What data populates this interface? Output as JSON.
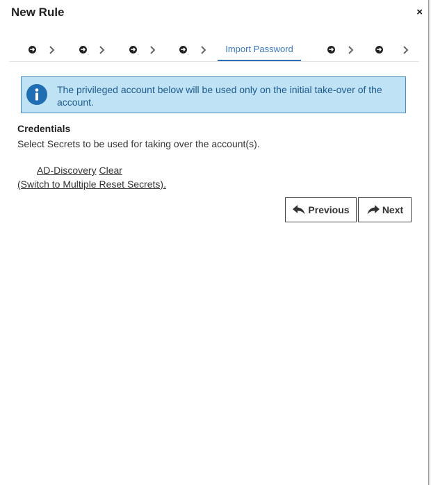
{
  "dialog": {
    "title": "New Rule",
    "close_icon": "×"
  },
  "wizard": {
    "steps": [
      {
        "icon": "arrow-circle-right-icon",
        "state": "pending"
      },
      {
        "icon": "arrow-circle-right-icon",
        "state": "pending"
      },
      {
        "icon": "arrow-circle-right-icon",
        "state": "pending"
      },
      {
        "icon": "arrow-circle-right-icon",
        "state": "pending"
      },
      {
        "label": "Import Password",
        "state": "active"
      },
      {
        "icon": "arrow-circle-right-icon",
        "state": "pending"
      },
      {
        "icon": "arrow-circle-right-icon",
        "state": "pending"
      }
    ],
    "active_label": "Import Password"
  },
  "info_banner": {
    "icon": "info-icon",
    "message": "The privileged account below will be used only on the initial take-over of the account."
  },
  "credentials": {
    "heading": "Credentials",
    "description": "Select Secrets to be used for taking over the account(s).",
    "secret_name": "AD-Discovery",
    "clear_label": "Clear",
    "switch_label": "(Switch to Multiple Reset Secrets)."
  },
  "buttons": {
    "previous_label": "Previous",
    "next_label": "Next"
  },
  "colors": {
    "accent": "#2a6fb8",
    "info_bg": "#bfe3f5",
    "info_border": "#4a8bbf",
    "info_text": "#1d5a8e"
  }
}
